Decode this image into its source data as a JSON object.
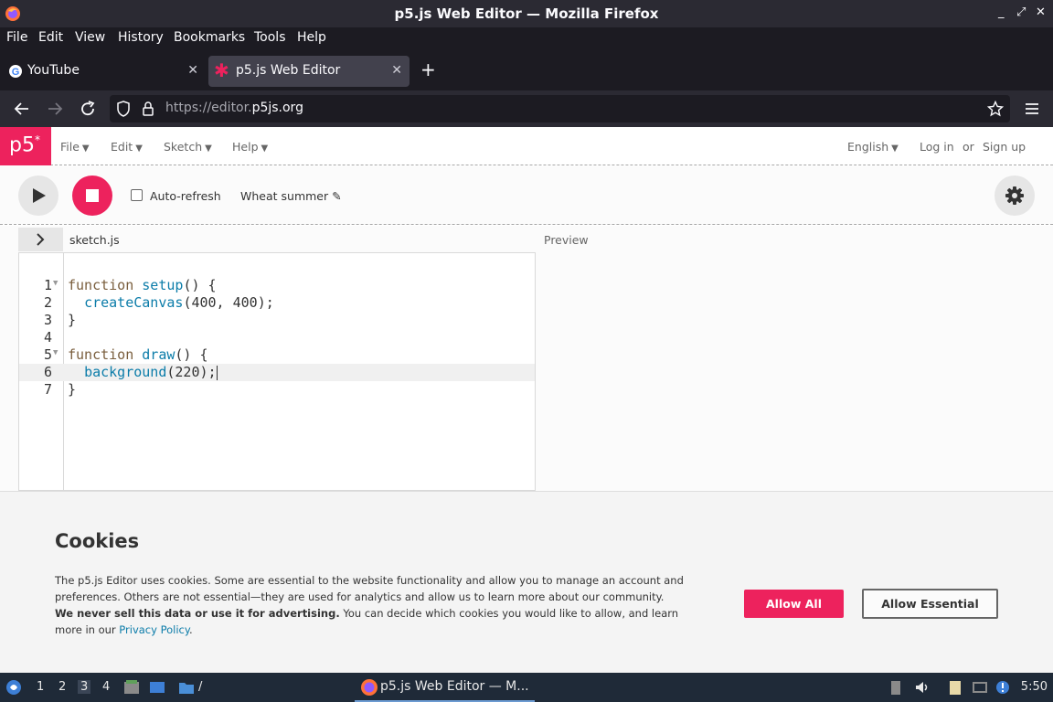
{
  "window": {
    "title": "p5.js Web Editor — Mozilla Firefox",
    "controls": [
      "_",
      "⤢",
      "✕"
    ]
  },
  "menubar": {
    "items": [
      "File",
      "Edit",
      "View",
      "History",
      "Bookmarks",
      "Tools",
      "Help"
    ]
  },
  "tabs": [
    {
      "label": "YouTube",
      "icon": "google-icon",
      "active": false
    },
    {
      "label": "p5.js Web Editor",
      "icon": "p5-asterisk-icon",
      "active": true
    }
  ],
  "navbar": {
    "url_prefix": "https://editor.",
    "url_domain": "p5js.org"
  },
  "p5header": {
    "logo": "p5",
    "logo_sup": "*",
    "menus": [
      "File",
      "Edit",
      "Sketch",
      "Help"
    ],
    "language": "English",
    "login": "Log in",
    "or": "or",
    "signup": "Sign up"
  },
  "toolbar": {
    "auto_refresh_label": "Auto-refresh",
    "auto_refresh_checked": false,
    "sketch_name": "Wheat summer"
  },
  "editor": {
    "filename": "sketch.js",
    "preview_label": "Preview",
    "line_numbers": [
      "1",
      "2",
      "3",
      "4",
      "5",
      "6",
      "7"
    ],
    "current_line": 6
  },
  "cookies": {
    "title": "Cookies",
    "text_1": "The p5.js Editor uses cookies. Some are essential to the website functionality and allow you to manage an account and preferences. Others are not essential—they are used for analytics and allow us to learn more about our community. ",
    "text_bold": "We never sell this data or use it for advertising.",
    "text_2": " You can decide which cookies you would like to allow, and learn more in our ",
    "link": "Privacy Policy",
    "text_end": ".",
    "allow_all": "Allow All",
    "allow_essential": "Allow Essential"
  },
  "taskbar": {
    "workspaces": [
      "1",
      "2",
      "3",
      "4"
    ],
    "active_workspace": "3",
    "task_label": "p5.js Web Editor — M...",
    "clock": "5:50"
  },
  "colors": {
    "p5_pink": "#ed225d",
    "keyword": "#7a5e3d",
    "function": "#0b7ca9"
  }
}
